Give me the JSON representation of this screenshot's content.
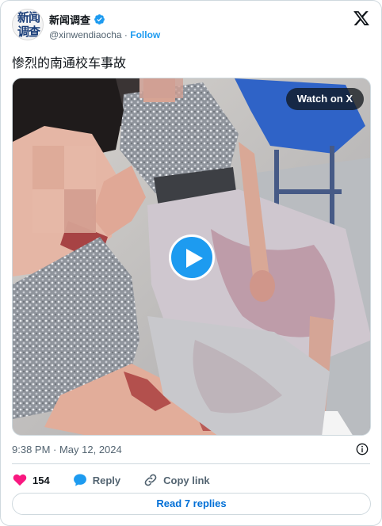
{
  "author": {
    "avatar_text": "新闻调查",
    "display_name": "新闻调查",
    "handle": "@xinwendiaocha",
    "separator": "·",
    "follow_label": "Follow",
    "avatar_icon": "news-logo-icon",
    "verified_icon": "verified-badge-icon"
  },
  "platform_icon": "x-logo-icon",
  "tweet": {
    "text": "惨烈的南通校车事故"
  },
  "media": {
    "watch_label": "Watch on X",
    "play_icon": "play-icon"
  },
  "meta": {
    "timestamp": "9:38 PM · May 12, 2024",
    "info_icon": "info-icon"
  },
  "actions": {
    "like_count": "154",
    "like_icon": "heart-icon",
    "reply_label": "Reply",
    "reply_icon": "speech-bubble-icon",
    "copy_label": "Copy link",
    "copy_icon": "link-icon"
  },
  "read_replies_label": "Read 7 replies",
  "colors": {
    "accent": "#1d9bf0",
    "heart": "#f91880",
    "link_text": "#006fd6",
    "secondary_text": "#536471"
  }
}
